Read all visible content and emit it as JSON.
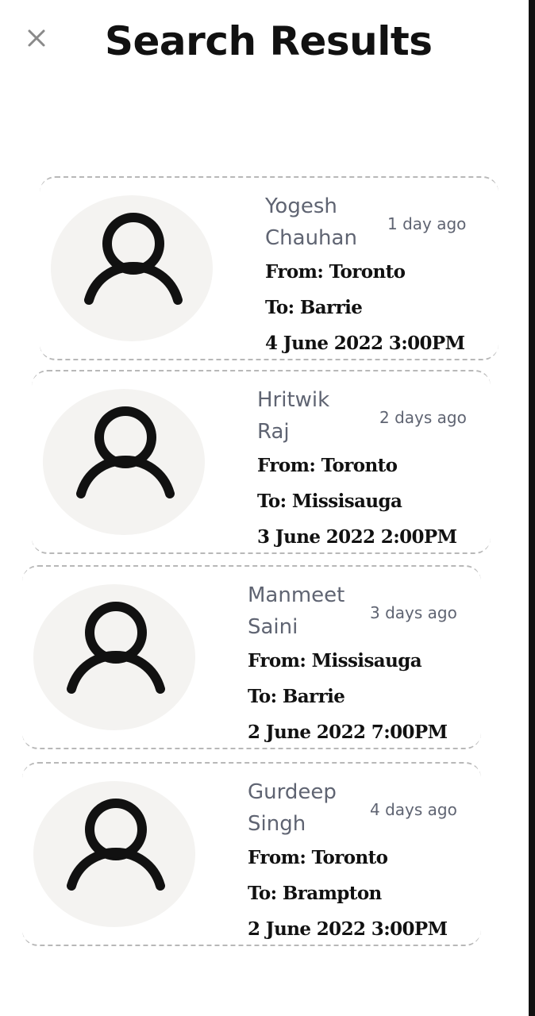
{
  "header": {
    "close_icon": "close-icon",
    "title": "Search Results"
  },
  "results": [
    {
      "first_name": "Yogesh",
      "last_name": "Chauhan",
      "time_ago": "1 day ago",
      "from": "From: Toronto",
      "to": "To: Barrie",
      "datetime": "4 June 2022 3:00PM"
    },
    {
      "first_name": "Hritwik",
      "last_name": "Raj",
      "time_ago": "2  days ago",
      "from": "From: Toronto",
      "to": "To: Missisauga",
      "datetime": "3 June 2022 2:00PM"
    },
    {
      "first_name": "Manmeet",
      "last_name": "Saini",
      "time_ago": "3 days ago",
      "from": "From: Missisauga",
      "to": "To: Barrie",
      "datetime": "2 June 2022 7:00PM"
    },
    {
      "first_name": "Gurdeep",
      "last_name": "Singh",
      "time_ago": "4 days ago",
      "from": "From: Toronto",
      "to": "To: Brampton",
      "datetime": "2 June 2022 3:00PM"
    }
  ],
  "icons": {
    "avatar": "user-icon",
    "close": "close-icon"
  }
}
